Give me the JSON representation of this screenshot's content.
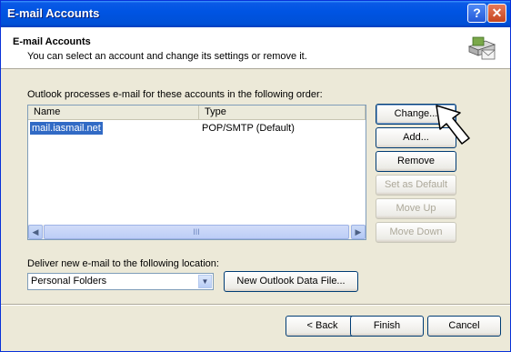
{
  "window": {
    "title": "E-mail Accounts",
    "help_button": "?",
    "close_button": "✕"
  },
  "header": {
    "title": "E-mail Accounts",
    "subtitle": "You can select an account and change its settings or remove it."
  },
  "accounts": {
    "order_label": "Outlook processes e-mail for these accounts in the following order:",
    "columns": [
      "Name",
      "Type"
    ],
    "rows": [
      {
        "name": "mail.iasmail.net",
        "type": "POP/SMTP (Default)"
      }
    ],
    "scroll_grip": "III"
  },
  "side_buttons": {
    "change": "Change...",
    "add": "Add...",
    "remove": "Remove",
    "set_default": "Set as Default",
    "move_up": "Move Up",
    "move_down": "Move Down"
  },
  "delivery": {
    "label": "Deliver new e-mail to the following location:",
    "selected": "Personal Folders",
    "new_file_button": "New Outlook Data File..."
  },
  "footer": {
    "back": "< Back",
    "finish": "Finish",
    "cancel": "Cancel"
  },
  "colors": {
    "titlebar": "#0054e3",
    "dialog_bg": "#ece9d8",
    "selection": "#316ac5"
  }
}
